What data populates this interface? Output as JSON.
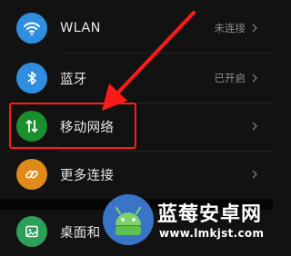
{
  "settings": {
    "items": [
      {
        "name": "wlan",
        "label": "WLAN",
        "value": "未连接",
        "icon": "wifi-icon",
        "color": "#2f8ee0"
      },
      {
        "name": "bluetooth",
        "label": "蓝牙",
        "value": "已开启",
        "icon": "bluetooth-icon",
        "color": "#2f8ee0"
      },
      {
        "name": "mobile-network",
        "label": "移动网络",
        "value": "",
        "icon": "mobile-data-icon",
        "color": "#1a8f2e"
      },
      {
        "name": "more-connections",
        "label": "更多连接",
        "value": "",
        "icon": "link-icon",
        "color": "#e08a1a"
      },
      {
        "name": "desktop",
        "label": "桌面和",
        "value": "",
        "icon": "image-icon",
        "color": "#2ca05a"
      }
    ]
  },
  "annotation": {
    "highlight_color": "#ff1a1a"
  },
  "watermark": {
    "title": "蓝莓安卓网",
    "url": "www.lmkjst.com"
  }
}
